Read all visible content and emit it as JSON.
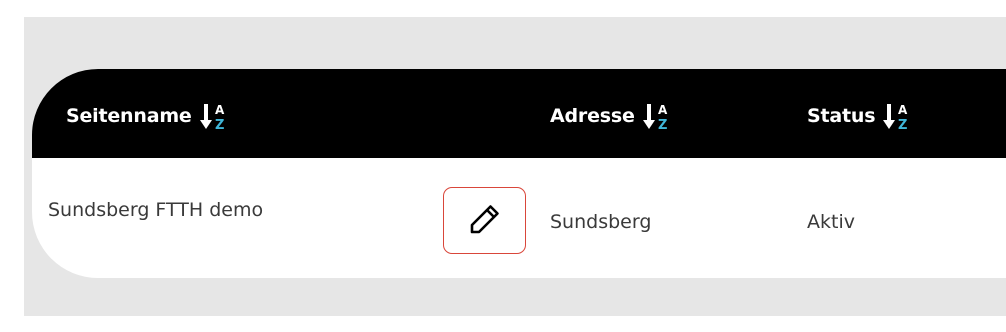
{
  "table": {
    "columns": [
      {
        "label": "Seitenname",
        "sort_icon": "sort-az-icon"
      },
      {
        "label": "Adresse",
        "sort_icon": "sort-az-icon"
      },
      {
        "label": "Status",
        "sort_icon": "sort-az-icon"
      }
    ],
    "rows": [
      {
        "name": "Sundsberg FTTH demo",
        "address": "Sundsberg",
        "status": "Aktiv",
        "action_icon": "pencil-icon"
      }
    ]
  },
  "colors": {
    "header_bg": "#000000",
    "header_text": "#ffffff",
    "sort_arrow": "#ffffff",
    "sort_letter_a": "#ffffff",
    "sort_letter_z": "#3fb6d8",
    "edit_border": "#d9463a",
    "page_bg": "#e6e6e6"
  }
}
